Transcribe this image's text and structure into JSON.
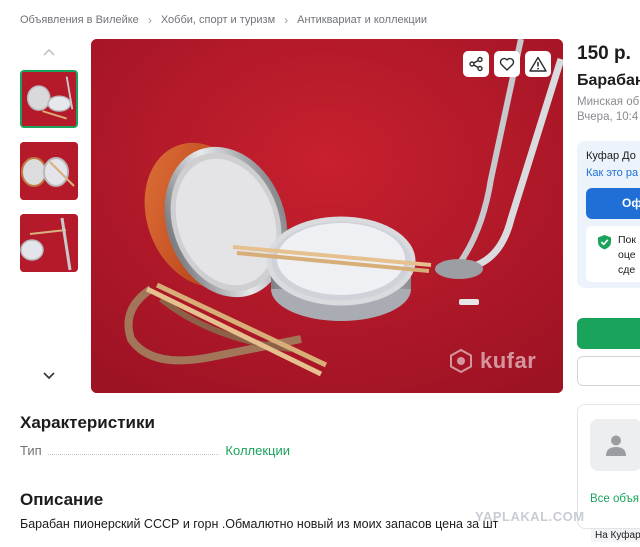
{
  "breadcrumbs": [
    "Объявления в Вилейке",
    "Хобби, спорт и туризм",
    "Антиквариат и коллекции"
  ],
  "photo": {
    "watermark": "kufar"
  },
  "listing": {
    "price": "150 р.",
    "title": "Барабан",
    "location": "Минская об",
    "posted": "Вчера, 10:4"
  },
  "delivery": {
    "title": "Куфар До",
    "link": "Как это ра",
    "button": "Оф",
    "safe_line1": "Пок",
    "safe_line2": "оце",
    "safe_line3": "сде"
  },
  "characteristics": {
    "heading": "Характеристики",
    "rows": [
      {
        "key": "Тип",
        "value": "Коллекции"
      }
    ]
  },
  "description": {
    "heading": "Описание",
    "text": "Барабан пионерский СССР и горн .Обмалютно новый из моих запасов цена за шт"
  },
  "seller": {
    "all_link": "Все объя"
  },
  "footer_tag": "На Куфар",
  "overlay_watermark": "YAPLAKAL.COM",
  "colors": {
    "accent_green": "#1aa35b",
    "delivery_blue": "#1f6fd6",
    "photo_background": "#b0182a"
  },
  "icons": [
    "chevron-up-icon",
    "chevron-down-icon",
    "share-icon",
    "heart-icon",
    "warning-icon",
    "shield-check-icon",
    "user-icon"
  ]
}
